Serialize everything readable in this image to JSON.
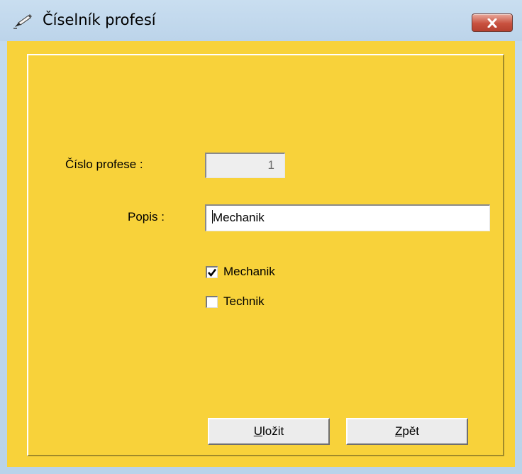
{
  "window": {
    "title": "Číselník profesí",
    "icon": "pen-icon",
    "close_icon": "close-x-icon",
    "accent_color": "#f8d23a"
  },
  "form": {
    "cislo_label": "Číslo profese :",
    "cislo_value": "1",
    "popis_label": "Popis :",
    "popis_value": "Mechanik"
  },
  "checkboxes": [
    {
      "label": "Mechanik",
      "checked": true
    },
    {
      "label": "Technik",
      "checked": false
    }
  ],
  "buttons": {
    "save_access_key": "U",
    "save_rest": "ložit",
    "back_access_key": "Z",
    "back_rest": "pět"
  }
}
